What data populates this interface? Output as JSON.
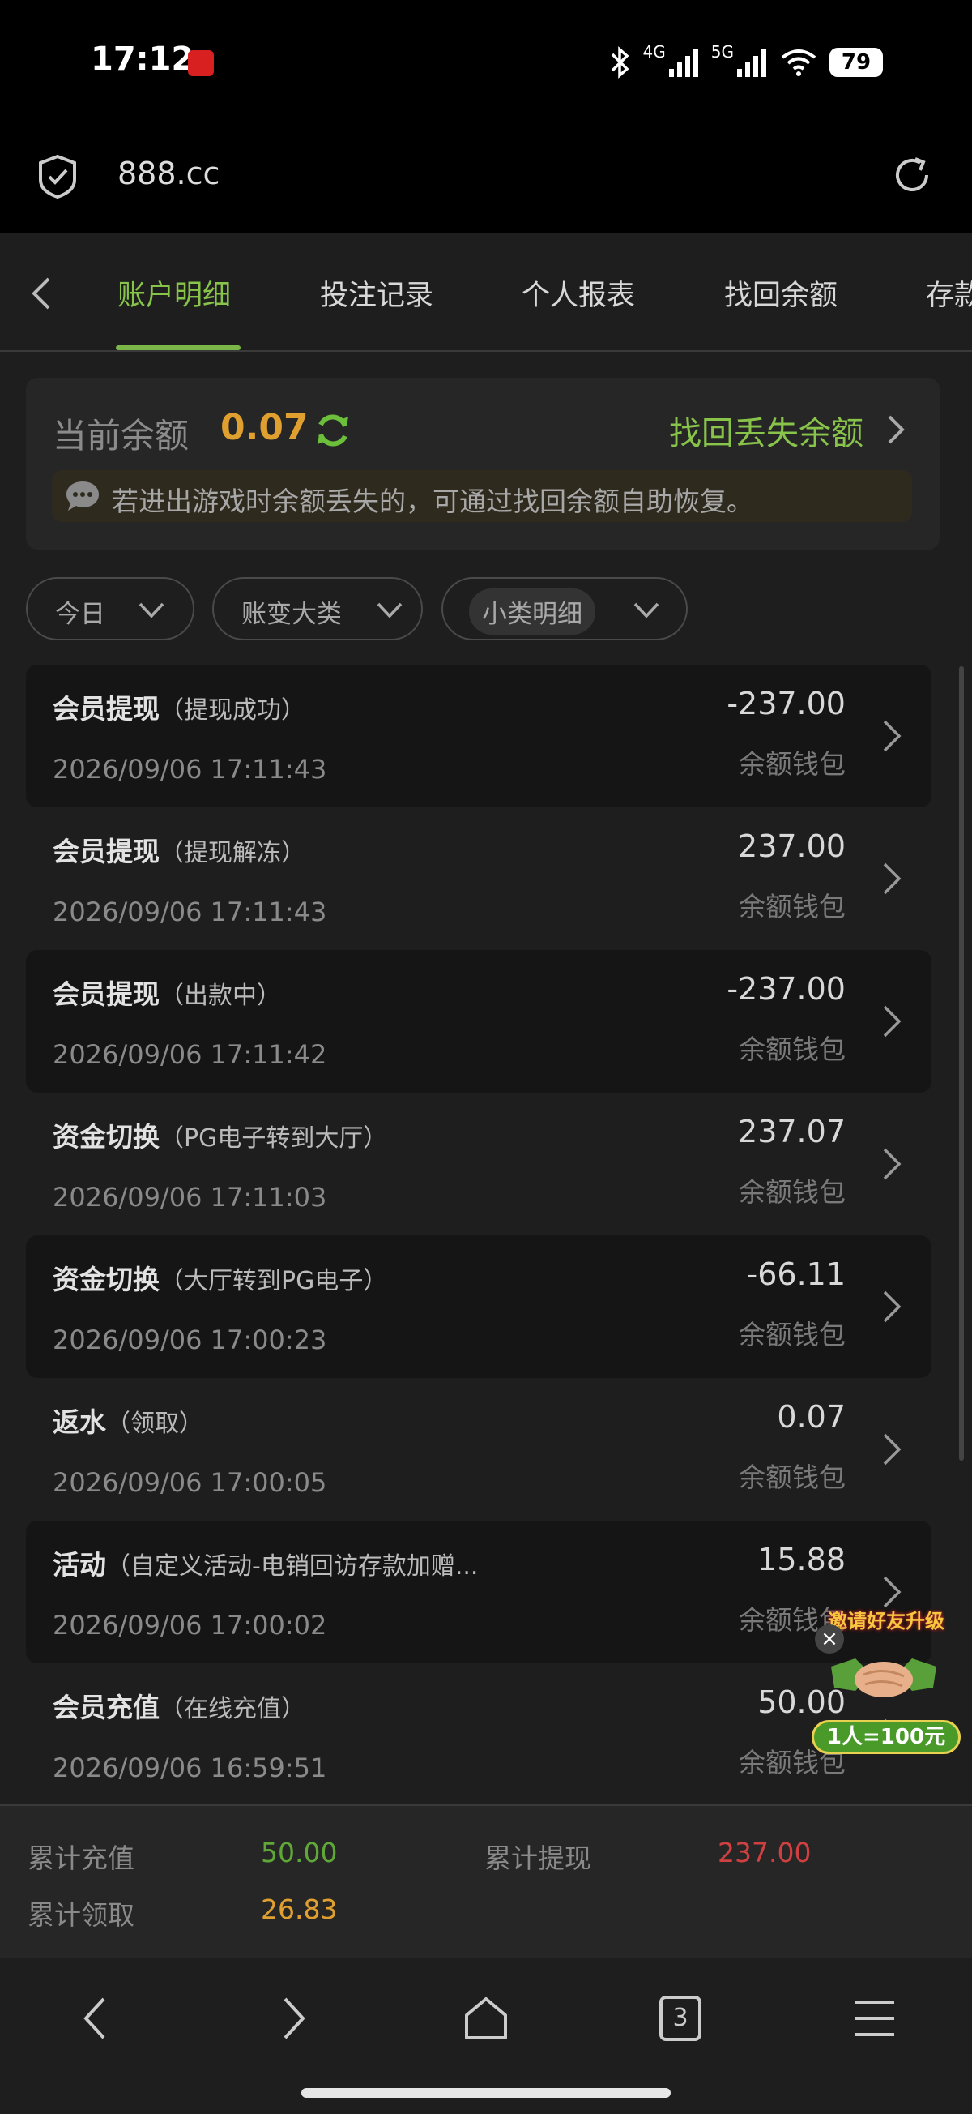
{
  "status_bar": {
    "time": "17:12",
    "network_1": "4G",
    "network_2": "5G",
    "battery": "79"
  },
  "browser": {
    "url": "888.cc"
  },
  "tabs": [
    {
      "label": "账户明细",
      "active": true
    },
    {
      "label": "投注记录",
      "active": false
    },
    {
      "label": "个人报表",
      "active": false
    },
    {
      "label": "找回余额",
      "active": false
    },
    {
      "label": "存款",
      "active": false
    }
  ],
  "balance": {
    "label": "当前余额",
    "value": "0.07",
    "recover_link": "找回丢失余额",
    "notice": "若进出游戏时余额丢失的，可通过找回余额自助恢复。"
  },
  "filters": [
    {
      "label": "今日"
    },
    {
      "label": "账变大类"
    },
    {
      "label": "小类明细"
    }
  ],
  "records": [
    {
      "title": "会员提现",
      "sub": "（提现成功）",
      "time": "2026/09/06 17:11:43",
      "amount": "-237.00",
      "wallet": "余额钱包"
    },
    {
      "title": "会员提现",
      "sub": "（提现解冻）",
      "time": "2026/09/06 17:11:43",
      "amount": "237.00",
      "wallet": "余额钱包"
    },
    {
      "title": "会员提现",
      "sub": "（出款中）",
      "time": "2026/09/06 17:11:42",
      "amount": "-237.00",
      "wallet": "余额钱包"
    },
    {
      "title": "资金切换",
      "sub": "（PG电子转到大厅）",
      "time": "2026/09/06 17:11:03",
      "amount": "237.07",
      "wallet": "余额钱包"
    },
    {
      "title": "资金切换",
      "sub": "（大厅转到PG电子）",
      "time": "2026/09/06 17:00:23",
      "amount": "-66.11",
      "wallet": "余额钱包"
    },
    {
      "title": "返水",
      "sub": "（领取）",
      "time": "2026/09/06 17:00:05",
      "amount": "0.07",
      "wallet": "余额钱包"
    },
    {
      "title": "活动",
      "sub": "（自定义活动-电销回访存款加赠...",
      "time": "2026/09/06 17:00:02",
      "amount": "15.88",
      "wallet": "余额钱包"
    },
    {
      "title": "会员充值",
      "sub": "（在线充值）",
      "time": "2026/09/06 16:59:51",
      "amount": "50.00",
      "wallet": "余额钱包"
    }
  ],
  "promo": {
    "headline": "邀请好友升级",
    "reward": "1人=100元"
  },
  "summary": {
    "total_deposit_label": "累计充值",
    "total_deposit": "50.00",
    "total_withdraw_label": "累计提现",
    "total_withdraw": "237.00",
    "total_claim_label": "累计领取",
    "total_claim": "26.83"
  },
  "nav": {
    "tab_count": "3"
  },
  "colors": {
    "accent_green": "#88c34a",
    "balance_gold": "#e0a030",
    "deposit_green": "#5fa838",
    "withdraw_red": "#d04040"
  }
}
